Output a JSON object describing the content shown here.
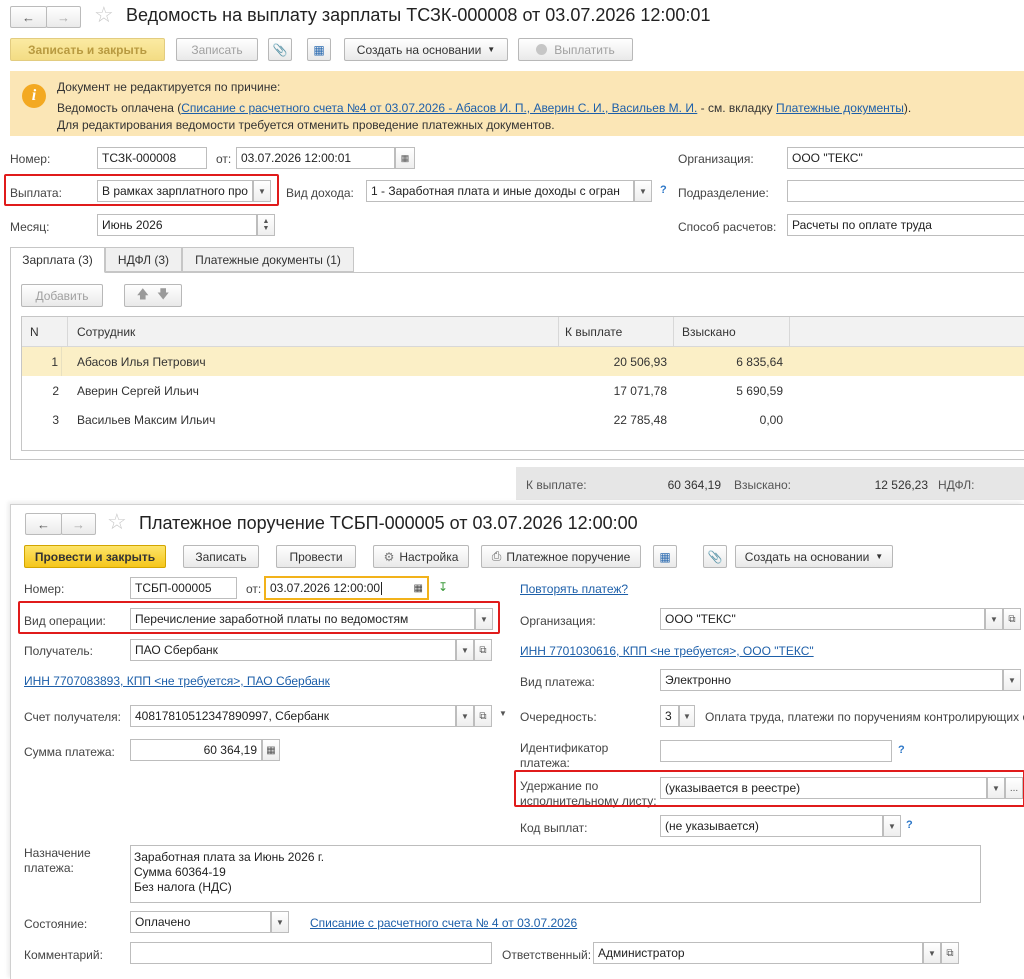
{
  "doc1": {
    "title": "Ведомость на выплату зарплаты ТСЗК-000008 от 03.07.2026 12:00:01",
    "toolbar": {
      "save_close": "Записать и закрыть",
      "save": "Записать",
      "create_based": "Создать на основании",
      "pay": "Выплатить"
    },
    "banner": {
      "line1": "Документ не редактируется по причине:",
      "line2_prefix": "Ведомость оплачена (",
      "line2_link": "Списание с расчетного счета №4 от 03.07.2026 - Абасов И. П., Аверин С. И., Васильев М. И.",
      "line2_mid": " - см. вкладку ",
      "line2_link2": "Платежные документы",
      "line2_suffix": ").",
      "line3": "Для редактирования ведомости требуется отменить проведение платежных документов."
    },
    "fields": {
      "number_label": "Номер:",
      "number_value": "ТСЗК-000008",
      "date_label": "от:",
      "date_value": "03.07.2026 12:00:01",
      "payment_label": "Выплата:",
      "payment_value": "В рамках зарплатного про",
      "income_label": "Вид дохода:",
      "income_value": "1 - Заработная плата и иные доходы с огран",
      "month_label": "Месяц:",
      "month_value": "Июнь 2026",
      "org_label": "Организация:",
      "org_value": "ООО \"ТЕКС\"",
      "dept_label": "Подразделение:",
      "dept_value": "",
      "method_label": "Способ расчетов:",
      "method_value": "Расчеты по оплате труда",
      "help": "?"
    },
    "tabs": [
      "Зарплата (3)",
      "НДФЛ (3)",
      "Платежные документы (1)"
    ],
    "add_button": "Добавить",
    "table": {
      "headers": [
        "N",
        "Сотрудник",
        "К выплате",
        "Взыскано"
      ],
      "rows": [
        {
          "n": "1",
          "name": "Абасов Илья Петрович",
          "pay": "20 506,93",
          "withheld": "6 835,64"
        },
        {
          "n": "2",
          "name": "Аверин Сергей Ильич",
          "pay": "17 071,78",
          "withheld": "5 690,59"
        },
        {
          "n": "3",
          "name": "Васильев Максим Ильич",
          "pay": "22 785,48",
          "withheld": "0,00"
        }
      ]
    },
    "footer": {
      "pay_label": "К выплате:",
      "pay_value": "60 364,19",
      "withheld_label": "Взыскано:",
      "withheld_value": "12 526,23",
      "ndfl_label": "НДФЛ:"
    }
  },
  "doc2": {
    "title": "Платежное поручение ТСБП-000005 от 03.07.2026 12:00:00",
    "toolbar": {
      "post_close": "Провести и закрыть",
      "save": "Записать",
      "post": "Провести",
      "settings": "Настройка",
      "payment_order": "Платежное поручение",
      "create_based": "Создать на основании"
    },
    "fields": {
      "number_label": "Номер:",
      "number_value": "ТСБП-000005",
      "date_label": "от:",
      "date_value": "03.07.2026 12:00:00",
      "repeat_link": "Повторять платеж?",
      "op_label": "Вид операции:",
      "op_value": "Перечисление заработной платы по ведомостям",
      "org_label": "Организация:",
      "org_value": "ООО \"ТЕКС\"",
      "recipient_label": "Получатель:",
      "recipient_value": "ПАО Сбербанк",
      "org_inn_link": "ИНН 7701030616, КПП <не требуется>, ООО \"ТЕКС\"",
      "recipient_inn_link": "ИНН 7707083893, КПП <не требуется>, ПАО Сбербанк",
      "paytype_label": "Вид платежа:",
      "paytype_value": "Электронно",
      "account_label": "Счет получателя:",
      "account_value": "40817810512347890997, Сбербанк",
      "priority_label": "Очередность:",
      "priority_value": "3",
      "priority_desc": "Оплата труда, платежи по поручениям контролирующих о",
      "amount_label": "Сумма платежа:",
      "amount_value": "60 364,19",
      "ident_label_1": "Идентификатор",
      "ident_label_2": "платежа:",
      "ident_value": "",
      "withhold_label_1": "Удержание по",
      "withhold_label_2": "исполнительному листу:",
      "withhold_value": "(указывается в реестре)",
      "paycode_label": "Код выплат:",
      "paycode_value": "(не указывается)",
      "purpose_label_1": "Назначение",
      "purpose_label_2": "платежа:",
      "purpose_lines": [
        "Заработная плата за Июнь 2026 г.",
        "Сумма 60364-19",
        "Без налога (НДС)"
      ],
      "state_label": "Состояние:",
      "state_value": "Оплачено",
      "state_link": "Списание с расчетного счета № 4 от 03.07.2026",
      "comment_label": "Комментарий:",
      "comment_value": "",
      "responsible_label": "Ответственный:",
      "responsible_value": "Администратор",
      "help": "?",
      "dots": "..."
    }
  }
}
